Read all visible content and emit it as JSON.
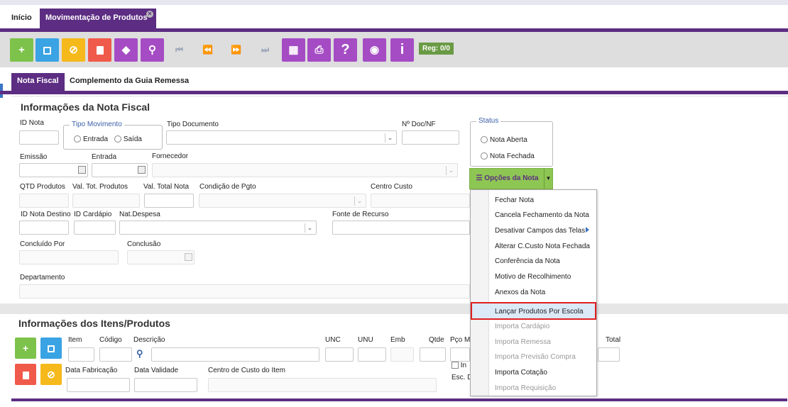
{
  "tabs": {
    "home": "Início",
    "current": "Movimentação de Produtos"
  },
  "toolbar": {
    "buttons": [
      {
        "name": "add-button",
        "glyph": "+",
        "icon": "plus-icon"
      },
      {
        "name": "save-button",
        "glyph": "▪",
        "icon": "save-icon"
      },
      {
        "name": "cancel-button",
        "glyph": "⊘",
        "icon": "cancel-icon"
      },
      {
        "name": "delete-button",
        "glyph": "▮",
        "icon": "trash-icon"
      },
      {
        "name": "clear-button",
        "glyph": "◆",
        "icon": "eraser-icon"
      },
      {
        "name": "search-button",
        "glyph": "⚲",
        "icon": "search-icon"
      },
      {
        "name": "table-button",
        "glyph": "▦",
        "icon": "table-icon"
      },
      {
        "name": "print-button",
        "glyph": "⎙",
        "icon": "printer-icon"
      },
      {
        "name": "help-button",
        "glyph": "?",
        "icon": "question-icon"
      },
      {
        "name": "view-button",
        "glyph": "◉",
        "icon": "eye-icon"
      },
      {
        "name": "info-button",
        "glyph": "i",
        "icon": "info-icon"
      }
    ],
    "nav": [
      "⏮",
      "⏪",
      "⏩",
      "⏭"
    ],
    "reg": "Reg: 0/0"
  },
  "subtabs": {
    "tab1": "Nota Fiscal",
    "tab2": "Complemento da Guia Remessa"
  },
  "nota": {
    "title": "Informações da Nota Fiscal",
    "id_nota": "ID Nota",
    "tipo_movimento": "Tipo Movimento",
    "entrada": "Entrada",
    "saida": "Saída",
    "tipo_documento": "Tipo Documento",
    "num_doc": "Nº Doc/NF",
    "status": "Status",
    "nota_aberta": "Nota Aberta",
    "nota_fechada": "Nota Fechada",
    "emissao": "Emissão",
    "entrada_data": "Entrada",
    "fornecedor": "Fornecedor",
    "qtd_produtos": "QTD Produtos",
    "val_tot_produtos": "Val. Tot. Produtos",
    "val_total_nota": "Val. Total Nota",
    "condicao_pgto": "Condição de Pgto",
    "centro_custo": "Centro Custo",
    "id_nota_destino": "ID Nota Destino",
    "id_cardapio": "ID Cardápio",
    "nat_despesa": "Nat.Despesa",
    "fonte_recurso": "Fonte de Recurso",
    "concluido_por": "Concluído Por",
    "conclusao": "Conclusão",
    "departamento": "Departamento"
  },
  "opcoes": {
    "label": "Opções da Nota",
    "items": [
      {
        "label": "Fechar Nota",
        "enabled": true
      },
      {
        "label": "Cancela Fechamento da Nota",
        "enabled": true
      },
      {
        "label": "Desativar Campos das Telas",
        "enabled": true
      },
      {
        "label": "Alterar C.Custo Nota Fechada",
        "enabled": true
      },
      {
        "label": "Conferência da Nota",
        "enabled": true
      },
      {
        "label": "Motivo de Recolhimento",
        "enabled": true
      },
      {
        "label": "Anexos da Nota",
        "enabled": true
      },
      {
        "label": "Lançar Produtos Por Escola",
        "enabled": true
      },
      {
        "label": "Importa Cardápio",
        "enabled": false
      },
      {
        "label": "Importa Remessa",
        "enabled": false
      },
      {
        "label": "Importa Previsão Compra",
        "enabled": false
      },
      {
        "label": "Importa Cotação",
        "enabled": true
      },
      {
        "label": "Importa Requisição",
        "enabled": false
      }
    ]
  },
  "itens": {
    "title": "Informações dos Itens/Produtos",
    "item": "Item",
    "codigo": "Código",
    "descricao": "Descrição",
    "unc": "UNC",
    "unu": "UNU",
    "emb": "Emb",
    "qtde": "Qtde",
    "pco": "Pço M",
    "total": "Total",
    "data_fabricacao": "Data Fabricação",
    "data_validade": "Data Validade",
    "centro_custo_item": "Centro de Custo do Item",
    "in": "In",
    "esc": "Esc. D"
  },
  "colors": {
    "purple": "#5c2d82",
    "green": "#7dc24b",
    "blue": "#3aa3e3",
    "yellow": "#f6b91b",
    "red": "#f05a4a",
    "magenta": "#a54cc4"
  }
}
